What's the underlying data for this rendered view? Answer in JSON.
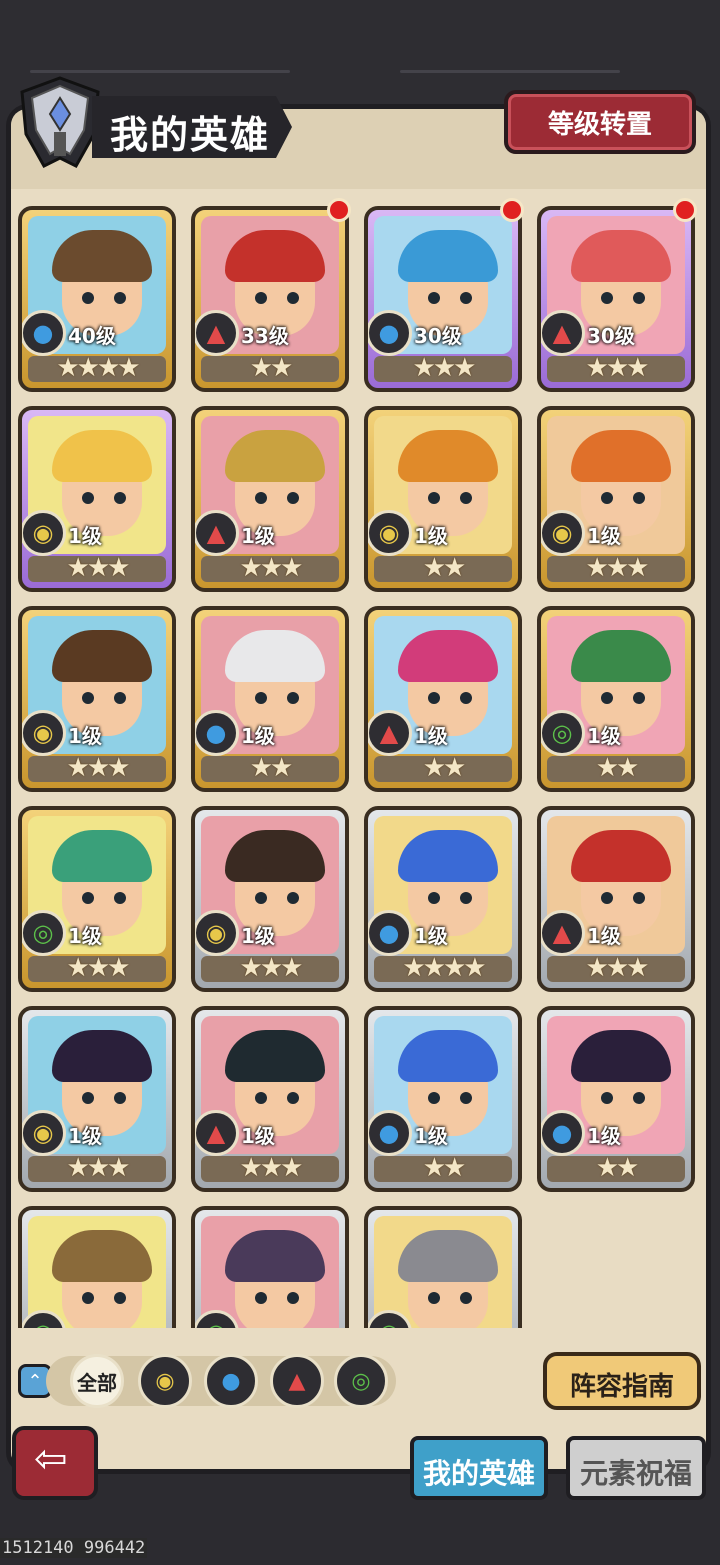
{
  "header": {
    "title": "我的英雄",
    "level_reset_label": "等级转置"
  },
  "heroes": [
    {
      "level": "40级",
      "stars": "★★★★",
      "element": "water",
      "frame": "gold",
      "badge": false
    },
    {
      "level": "33级",
      "stars": "★★",
      "element": "fire",
      "frame": "gold",
      "badge": true
    },
    {
      "level": "30级",
      "stars": "★★★",
      "element": "water",
      "frame": "purple",
      "badge": true
    },
    {
      "level": "30级",
      "stars": "★★★",
      "element": "fire",
      "frame": "purple",
      "badge": true
    },
    {
      "level": "1级",
      "stars": "★★★",
      "element": "earth",
      "frame": "purple",
      "badge": false
    },
    {
      "level": "1级",
      "stars": "★★★",
      "element": "fire",
      "frame": "gold",
      "badge": false
    },
    {
      "level": "1级",
      "stars": "★★",
      "element": "earth",
      "frame": "gold",
      "badge": false
    },
    {
      "level": "1级",
      "stars": "★★★",
      "element": "earth",
      "frame": "gold",
      "badge": false
    },
    {
      "level": "1级",
      "stars": "★★★",
      "element": "earth",
      "frame": "gold",
      "badge": false
    },
    {
      "level": "1级",
      "stars": "★★",
      "element": "water",
      "frame": "gold",
      "badge": false
    },
    {
      "level": "1级",
      "stars": "★★",
      "element": "fire",
      "frame": "gold",
      "badge": false
    },
    {
      "level": "1级",
      "stars": "★★",
      "element": "wind",
      "frame": "gold",
      "badge": false
    },
    {
      "level": "1级",
      "stars": "★★★",
      "element": "wind",
      "frame": "gold",
      "badge": false
    },
    {
      "level": "1级",
      "stars": "★★★",
      "element": "earth",
      "frame": "silver",
      "badge": false
    },
    {
      "level": "1级",
      "stars": "★★★★",
      "element": "water",
      "frame": "silver",
      "badge": false
    },
    {
      "level": "1级",
      "stars": "★★★",
      "element": "fire",
      "frame": "silver",
      "badge": false
    },
    {
      "level": "1级",
      "stars": "★★★",
      "element": "earth",
      "frame": "silver",
      "badge": false
    },
    {
      "level": "1级",
      "stars": "★★★",
      "element": "fire",
      "frame": "silver",
      "badge": false
    },
    {
      "level": "1级",
      "stars": "★★",
      "element": "water",
      "frame": "silver",
      "badge": false
    },
    {
      "level": "1级",
      "stars": "★★",
      "element": "water",
      "frame": "silver",
      "badge": false
    },
    {
      "level": "",
      "stars": "",
      "element": "wind",
      "frame": "silver",
      "badge": false
    },
    {
      "level": "",
      "stars": "",
      "element": "wind",
      "frame": "silver",
      "badge": false
    },
    {
      "level": "",
      "stars": "",
      "element": "wind",
      "frame": "silver",
      "badge": false
    }
  ],
  "filters": {
    "all_label": "全部",
    "items": [
      "earth",
      "water",
      "fire",
      "wind"
    ]
  },
  "guide_label": "阵容指南",
  "tabs": {
    "my_heroes": "我的英雄",
    "element_blessing": "元素祝福"
  },
  "footer_id": "1512140 996442",
  "colors": {
    "earth": "#e7c84a",
    "water": "#3f9be0",
    "fire": "#e24a4a",
    "wind": "#5cc04a"
  }
}
